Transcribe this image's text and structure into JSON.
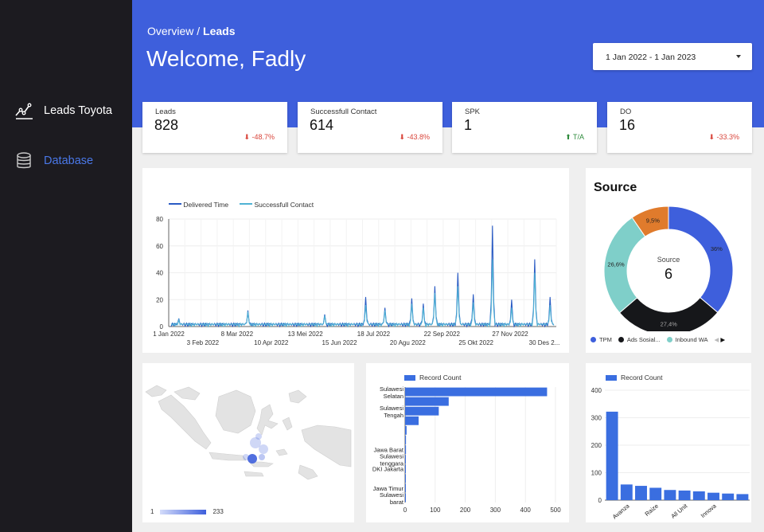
{
  "sidebar": {
    "items": [
      {
        "label": "Leads Toyota",
        "icon": "line-chart-icon"
      },
      {
        "label": "Database",
        "icon": "database-icon"
      }
    ]
  },
  "header": {
    "breadcrumb_parent": "Overview",
    "breadcrumb_sep": "/",
    "breadcrumb_current": "Leads",
    "welcome": "Welcome, Fadly",
    "date_range": "1 Jan 2022 - 1 Jan 2023"
  },
  "kpis": [
    {
      "title": "Leads",
      "value": "828",
      "delta": "-48.7%",
      "direction": "down"
    },
    {
      "title": "Successfull Contact",
      "value": "614",
      "delta": "-43.8%",
      "direction": "down"
    },
    {
      "title": "SPK",
      "value": "1",
      "delta": "T/A",
      "direction": "up"
    },
    {
      "title": "DO",
      "value": "16",
      "delta": "-33.3%",
      "direction": "down"
    }
  ],
  "colors": {
    "accent": "#3e5fdc",
    "sidebar": "#1c1b20",
    "series_dark": "#2a5bc4",
    "series_light": "#4fb3d4",
    "orange": "#e07b2c",
    "teal": "#7fcfc9",
    "black": "#16171a"
  },
  "chart_data": [
    {
      "type": "line",
      "legend": [
        "Delivered Time",
        "Successfull Contact"
      ],
      "ylim": [
        0,
        80
      ],
      "yticks": [
        "0",
        "20",
        "40",
        "60",
        "80"
      ],
      "xticks_top": [
        "1 Jan 2022",
        "8 Mar 2022",
        "13 Mei 2022",
        "18 Jul 2022",
        "22 Sep 2022",
        "27 Nov 2022"
      ],
      "xticks_bottom": [
        "3 Feb 2022",
        "10 Apr 2022",
        "15 Jun 2022",
        "20 Agu 2022",
        "25 Okt 2022",
        "30 Des 2..."
      ],
      "series": [
        {
          "name": "Delivered Time",
          "peaks": [
            [
              0.02,
              6
            ],
            [
              0.2,
              12
            ],
            [
              0.4,
              9
            ],
            [
              0.51,
              22
            ],
            [
              0.56,
              14
            ],
            [
              0.63,
              21
            ],
            [
              0.66,
              17
            ],
            [
              0.69,
              30
            ],
            [
              0.75,
              40
            ],
            [
              0.79,
              24
            ],
            [
              0.84,
              75
            ],
            [
              0.89,
              20
            ],
            [
              0.95,
              50
            ],
            [
              0.99,
              22
            ]
          ]
        },
        {
          "name": "Successfull Contact",
          "peaks": [
            [
              0.02,
              5
            ],
            [
              0.2,
              11
            ],
            [
              0.4,
              8
            ],
            [
              0.51,
              16
            ],
            [
              0.56,
              12
            ],
            [
              0.63,
              17
            ],
            [
              0.66,
              14
            ],
            [
              0.69,
              25
            ],
            [
              0.75,
              30
            ],
            [
              0.79,
              18
            ],
            [
              0.84,
              50
            ],
            [
              0.89,
              14
            ],
            [
              0.95,
              40
            ],
            [
              0.99,
              16
            ]
          ]
        }
      ]
    },
    {
      "type": "pie",
      "title": "Source",
      "center_label": "Source",
      "center_value": "6",
      "slices": [
        {
          "name": "TPM",
          "value": 36,
          "label": "36%",
          "color": "#3e5fdc"
        },
        {
          "name": "Ads Sosial...",
          "value": 27.4,
          "label": "27,4%",
          "color": "#16171a"
        },
        {
          "name": "Inbound WA",
          "value": 26.6,
          "label": "26,6%",
          "color": "#7fcfc9"
        },
        {
          "name": "",
          "value": 9.5,
          "label": "9,5%",
          "color": "#e07b2c"
        }
      ]
    },
    {
      "type": "bar",
      "orientation": "horizontal",
      "legend": "Record Count",
      "categories": [
        "Sulawesi Selatan",
        "",
        "Sulawesi Tengah",
        "",
        "",
        "",
        "Jawa Barat",
        "Sulawesi tenggara",
        "DKI Jakarta",
        "",
        "Jawa Timur",
        "Sulawesi barat"
      ],
      "values": [
        472,
        145,
        112,
        45,
        5,
        3,
        3,
        2,
        2,
        2,
        1,
        1
      ],
      "xlim": [
        0,
        500
      ],
      "xticks": [
        "0",
        "100",
        "200",
        "300",
        "400",
        "500"
      ]
    },
    {
      "type": "bar",
      "legend": "Record Count",
      "categories": [
        "",
        "Avanza",
        "",
        "Raize",
        "",
        "All Unit",
        "",
        "Innova",
        "",
        ""
      ],
      "values": [
        322,
        57,
        52,
        45,
        37,
        35,
        32,
        27,
        24,
        22
      ],
      "ylim": [
        0,
        400
      ],
      "yticks": [
        "0",
        "100",
        "200",
        "300",
        "400"
      ]
    }
  ],
  "map": {
    "legend_min": "1",
    "legend_max": "233"
  }
}
